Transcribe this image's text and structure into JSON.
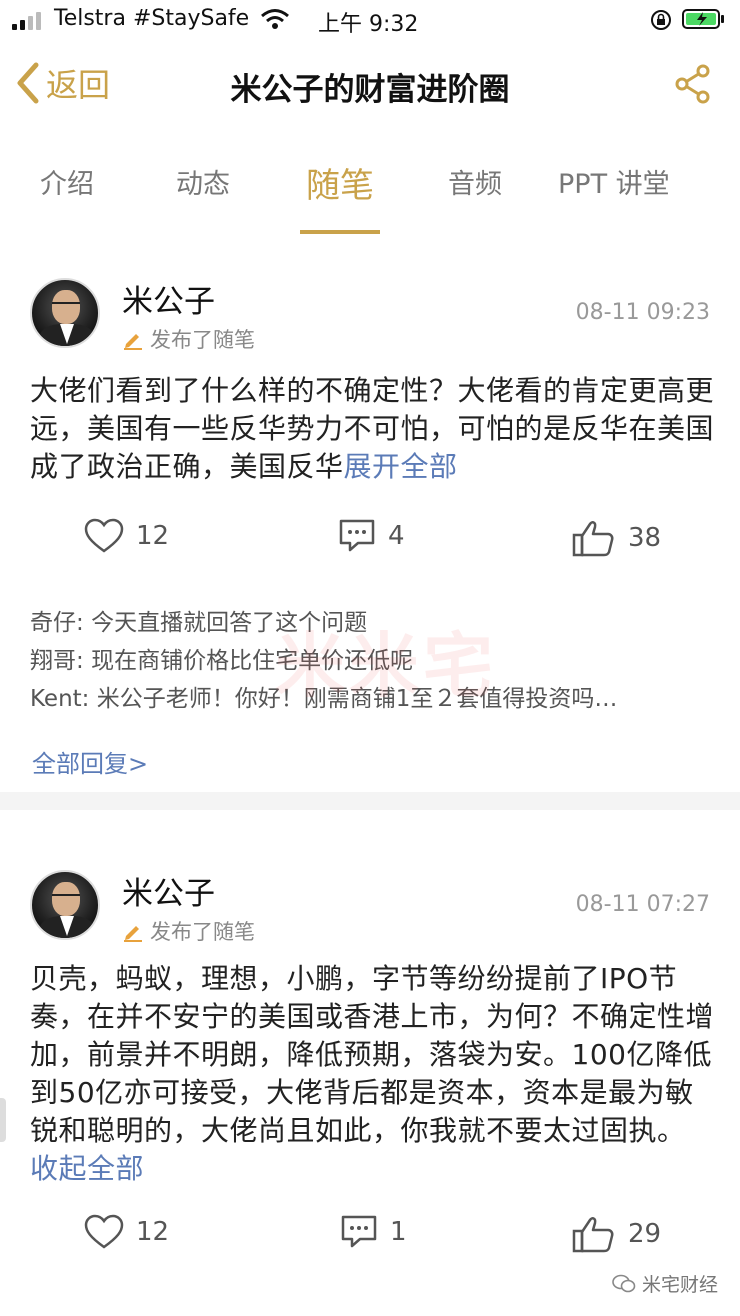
{
  "status_bar": {
    "carrier": "Telstra #StaySafe",
    "time": "上午 9:32"
  },
  "nav": {
    "back_label": "返回",
    "title": "米公子的财富进阶圈"
  },
  "tabs": [
    "介绍",
    "动态",
    "随笔",
    "音频",
    "PPT 讲堂"
  ],
  "active_tab": "随笔",
  "accent_color": "#c9a24a",
  "link_color": "#5b7bb7",
  "watermark": "米米宅",
  "posts": [
    {
      "author": "米公子",
      "action": "发布了随笔",
      "time": "08-11 09:23",
      "text": "大佬们看到了什么样的不确定性？大佬看的肯定更高更远，美国有一些反华势力不可怕，可怕的是反华在美国成了政治正确，美国反华",
      "toggle": "展开全部",
      "likes": "12",
      "comments": "4",
      "thumbs": "38",
      "replies": [
        {
          "user": "奇仔: ",
          "text": "今天直播就回答了这个问题"
        },
        {
          "user": "翔哥: ",
          "text": "现在商铺价格比住宅单价还低呢"
        },
        {
          "user": "Kent: ",
          "text": "米公子老师！你好！刚需商铺1至２套值得投资吗…"
        }
      ],
      "all_replies": "全部回复>"
    },
    {
      "author": "米公子",
      "action": "发布了随笔",
      "time": "08-11 07:27",
      "text": "贝壳，蚂蚁，理想，小鹏，字节等纷纷提前了IPO节奏，在并不安宁的美国或香港上市，为何？不确定性增加，前景并不明朗，降低预期，落袋为安。100亿降低到50亿亦可接受，大佬背后都是资本，资本是最为敏锐和聪明的，大佬尚且如此，你我就不要太过固执。",
      "toggle": "收起全部",
      "likes": "12",
      "comments": "1",
      "thumbs": "29"
    }
  ],
  "bottom_watermark": "米宅财经"
}
